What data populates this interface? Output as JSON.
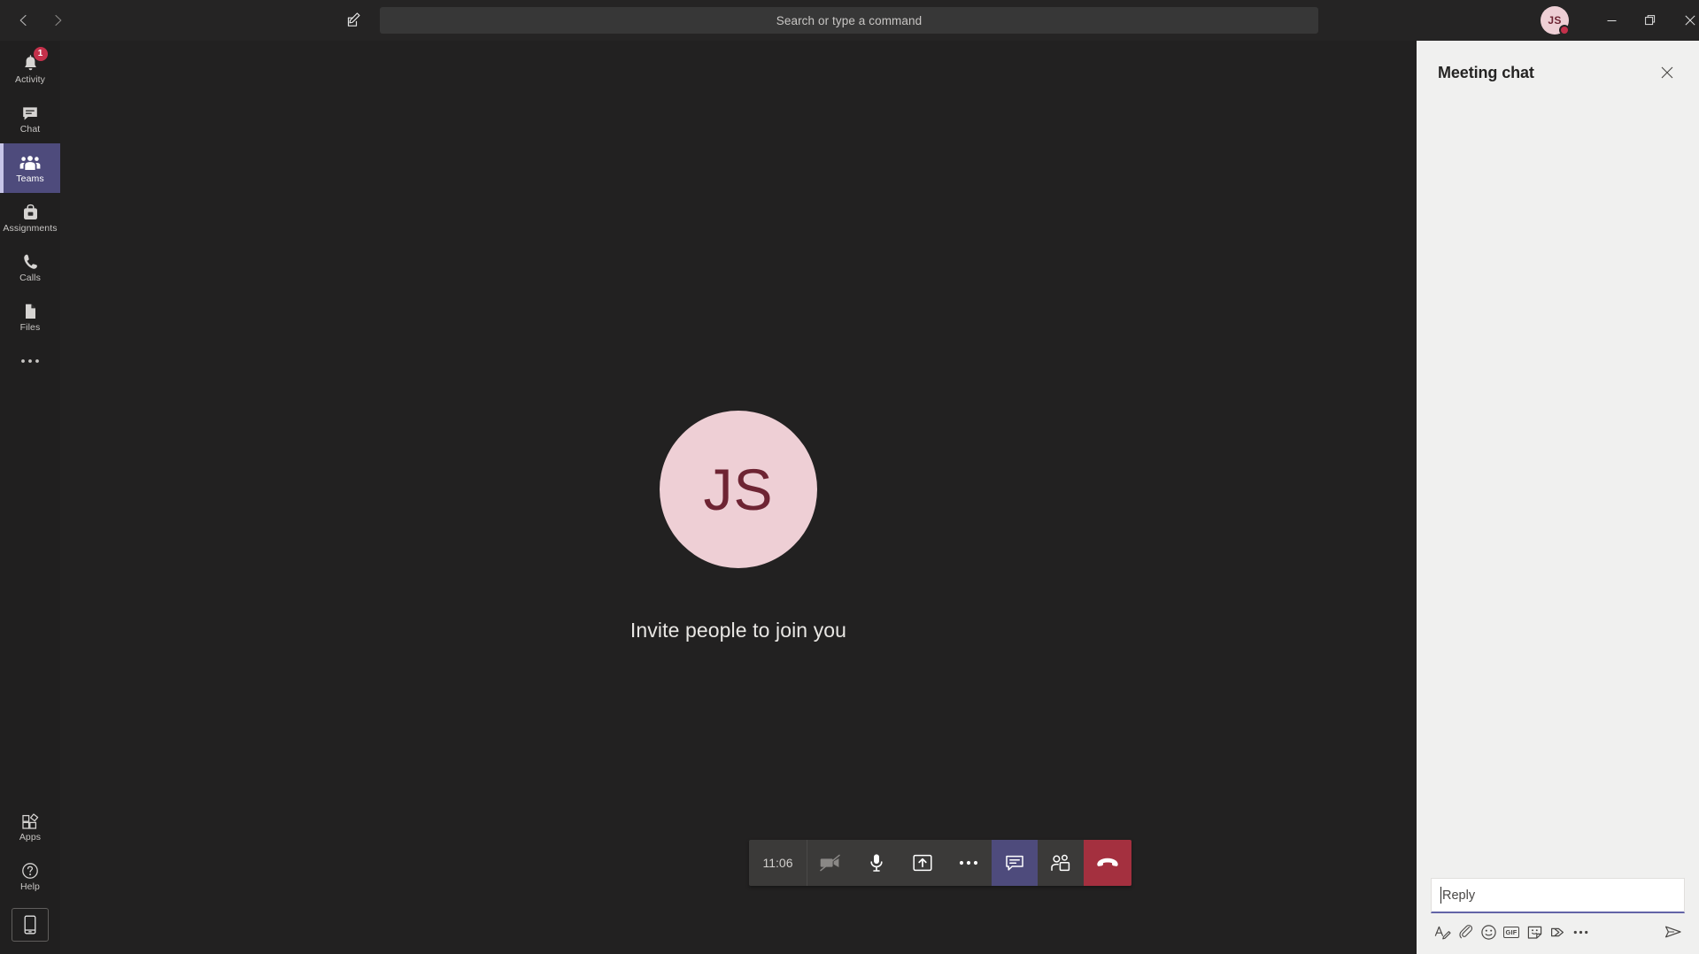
{
  "app": {
    "title": "Microsoft Teams",
    "theme": "dark"
  },
  "titlebar": {
    "back_icon": "chevron-left-icon",
    "forward_icon": "chevron-right-icon",
    "compose_icon": "compose-new-chat-icon",
    "search_placeholder": "Search or type a command",
    "user_avatar_initials": "JS",
    "user_presence": "busy",
    "minimize_label": "Minimize",
    "maximize_label": "Restore",
    "close_label": "Close"
  },
  "rail": {
    "items": [
      {
        "label": "Activity",
        "icon": "bell-icon",
        "badge": "1",
        "active": false
      },
      {
        "label": "Chat",
        "icon": "chat-bubble-icon",
        "badge": "",
        "active": false
      },
      {
        "label": "Teams",
        "icon": "teams-people-icon",
        "badge": "",
        "active": true
      },
      {
        "label": "Assignments",
        "icon": "assignments-bag-icon",
        "badge": "",
        "active": false
      },
      {
        "label": "Calls",
        "icon": "phone-icon",
        "badge": "",
        "active": false
      },
      {
        "label": "Files",
        "icon": "file-page-icon",
        "badge": "",
        "active": false
      }
    ],
    "more_label": "More apps",
    "bottom_items": [
      {
        "label": "Apps",
        "icon": "apps-grid-icon"
      },
      {
        "label": "Help",
        "icon": "help-circle-icon"
      }
    ],
    "device_label": "Download the mobile app"
  },
  "stage": {
    "avatar_initials": "JS",
    "invite_text": "Invite people to join you"
  },
  "controls": {
    "timer": "11:06",
    "buttons": [
      {
        "name": "camera-off-button",
        "icon": "camera-off-icon",
        "label": "Turn camera on",
        "state": "off"
      },
      {
        "name": "microphone-button",
        "icon": "microphone-icon",
        "label": "Mute",
        "state": "on"
      },
      {
        "name": "share-screen-button",
        "icon": "share-screen-icon",
        "label": "Share content",
        "state": "on"
      },
      {
        "name": "more-actions-button",
        "icon": "ellipsis-icon",
        "label": "More actions",
        "state": "on"
      },
      {
        "name": "show-conversation-button",
        "icon": "chat-bubble-icon",
        "label": "Show conversation",
        "state": "active"
      },
      {
        "name": "show-participants-button",
        "icon": "people-icon",
        "label": "Show participants",
        "state": "on"
      },
      {
        "name": "hangup-button",
        "icon": "hangup-phone-icon",
        "label": "Hang up",
        "state": "danger"
      }
    ]
  },
  "chat_panel": {
    "title": "Meeting chat",
    "close_label": "Close",
    "messages": [],
    "compose": {
      "placeholder": "Reply",
      "value": "",
      "tools": [
        {
          "name": "format-button",
          "icon": "format-text-icon",
          "label": "Format"
        },
        {
          "name": "attach-button",
          "icon": "paperclip-icon",
          "label": "Attach"
        },
        {
          "name": "emoji-button",
          "icon": "emoji-smiley-icon",
          "label": "Emoji"
        },
        {
          "name": "giphy-button",
          "icon": "gif-icon",
          "label": "Giphy"
        },
        {
          "name": "sticker-button",
          "icon": "sticker-icon",
          "label": "Sticker"
        },
        {
          "name": "praise-button",
          "icon": "praise-ribbon-icon",
          "label": "Praise"
        },
        {
          "name": "more-options-button",
          "icon": "ellipsis-icon",
          "label": "More options"
        }
      ],
      "send": {
        "name": "send-button",
        "icon": "send-paper-plane-icon",
        "label": "Send"
      }
    }
  },
  "colors": {
    "app_bg": "#201f1f",
    "titlebar_bg": "#252424",
    "stage_bg": "#222121",
    "accent_purple": "#6264a7",
    "rail_active": "#4e4b7c",
    "danger_red": "#c4314b",
    "hangup_red": "#a4303f",
    "chat_panel_bg": "#f0f0ef",
    "avatar_bg": "#eecfd5",
    "avatar_fg": "#6e2433"
  }
}
